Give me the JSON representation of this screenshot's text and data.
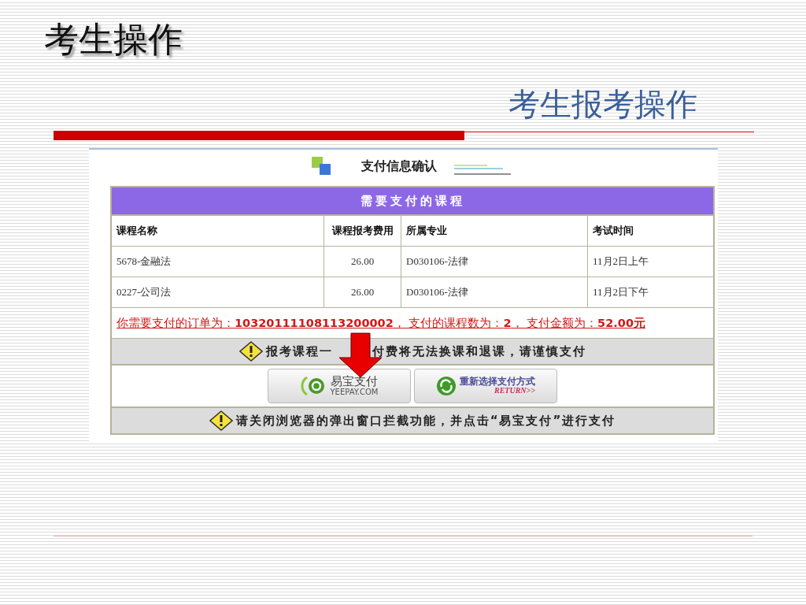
{
  "slide": {
    "title": "考生操作",
    "subtitle": "考生报考操作"
  },
  "page": {
    "heading": "支付信息确认",
    "table": {
      "caption": "需要支付的课程",
      "columns": [
        "课程名称",
        "课程报考费用",
        "所属专业",
        "考试时间"
      ],
      "rows": [
        {
          "cells": [
            "5678-金融法",
            "26.00",
            "D030106-法律",
            "11月2日上午"
          ]
        },
        {
          "cells": [
            "0227-公司法",
            "26.00",
            "D030106-法律",
            "11月2日下午"
          ]
        }
      ]
    },
    "order_line": "你需要支付的订单为：**10320111108113200002**，  支付的课程数为：**2**，  支付金额为：**52.00元**",
    "warning": {
      "before_arrow": "报考课程一",
      "after_arrow": "付费将无法换课和退课，请谨慎支付"
    },
    "pay_button": {
      "name": "易宝支付",
      "domain": "YEEPAY.COM"
    },
    "return_button": {
      "label": "重新选择支付方式",
      "sub": "RETURN>>"
    },
    "notice": "请关闭浏览器的弹出窗口拦截功能，并点击“易宝支付”进行支付"
  }
}
